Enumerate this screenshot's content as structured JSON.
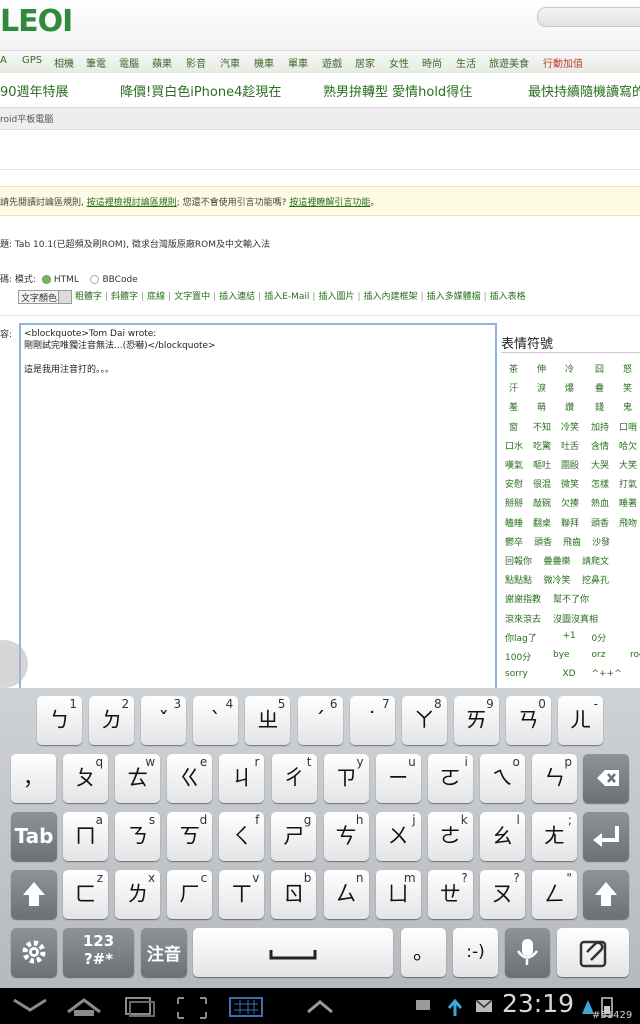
{
  "header": {
    "logo_text": "LEOI",
    "nav": [
      "A",
      "GPS",
      "相機",
      "筆電",
      "電腦",
      "蘋果",
      "影音",
      "汽車",
      "機車",
      "單車",
      "遊戲",
      "居家",
      "女性",
      "時尚",
      "生活",
      "旅遊美食",
      "行動加值"
    ],
    "marquee": [
      "90週年特展",
      "降價!買白色iPhone4趁現在",
      "熟男拚轉型 愛情hold得住",
      "最快持續隨機讀寫的"
    ],
    "breadcrumb": "roid平板電腦"
  },
  "notice": {
    "prefix": "請先閱讀討論區規則,",
    "link1": "按這裡檢視討論區規則",
    "middle": "; 您還不會使用引言功能嗎?",
    "link2": "按這裡瞭解引言功能",
    "suffix": "。"
  },
  "form": {
    "subject_label": "題:",
    "subject_value": "Tab 10.1(已超頻及刷ROM), 徵求台灣版原廠ROM及中文輸入法",
    "mode_label": "模式:",
    "mode_html": "HTML",
    "mode_bbcode": "BBCode",
    "mode_prefix": "碼:",
    "color_select": "文字顏色",
    "tools": [
      "粗體字",
      "斜體字",
      "底線",
      "文字置中",
      "插入連結",
      "插入E-Mail",
      "插入圖片",
      "插入內建框架",
      "插入多媒體檔",
      "插入表格"
    ],
    "content_label": "容:",
    "content_lines": [
      "<blockquote>Tom Dai wrote:",
      "剛剛試完唯獨注音無法...(恐嚇)</blockquote>",
      "",
      "這是我用注音打的。。。"
    ]
  },
  "emoticons": {
    "title": "表情符號",
    "rows": [
      [
        "茶",
        "伸",
        "冷",
        "囧",
        "怒"
      ],
      [
        "汗",
        "淚",
        "爆",
        "疊",
        "笑"
      ],
      [
        "羞",
        "萌",
        "讚",
        "錢",
        "鬼"
      ],
      [
        "窗",
        "不知",
        "冷笑",
        "加持",
        "口哨"
      ],
      [
        "口水",
        "吃驚",
        "吐舌",
        "含情",
        "哈欠"
      ],
      [
        "嘆氣",
        "嘔吐",
        "圍毆",
        "大哭",
        "大笑"
      ],
      [
        "安慰",
        "很混",
        "微笑",
        "怎樣",
        "打氣"
      ],
      [
        "掰掰",
        "敲碗",
        "欠揍",
        "熱血",
        "睡著"
      ],
      [
        "瞌睡",
        "翻桌",
        "聯拜",
        "頭香",
        "飛吻"
      ],
      [
        "鬱卒",
        "頭香",
        "飛齒",
        "沙發"
      ],
      [
        "回報你",
        "疊疊樂",
        "請爬文"
      ],
      [
        "點點點",
        "微冷笑",
        "挖鼻孔"
      ],
      [
        "謝謝指教",
        "幫不了你"
      ],
      [
        "滾來滾去",
        "沒圖沒真相"
      ],
      [
        "你lag了",
        "+1",
        "0分"
      ],
      [
        "100分",
        "bye",
        "orz",
        "rock"
      ],
      [
        "sorry",
        "XD",
        "^++^"
      ]
    ]
  },
  "keyboard": {
    "row1": [
      [
        "ㄅ",
        "1"
      ],
      [
        "ㄉ",
        "2"
      ],
      [
        "ˇ",
        "3"
      ],
      [
        "ˋ",
        "4"
      ],
      [
        "ㄓ",
        "5"
      ],
      [
        "ˊ",
        "6"
      ],
      [
        "˙",
        "7"
      ],
      [
        "ㄚ",
        "8"
      ],
      [
        "ㄞ",
        "9"
      ],
      [
        "ㄢ",
        "0"
      ],
      [
        "ㄦ",
        "-"
      ]
    ],
    "row2": [
      [
        "，",
        ""
      ],
      [
        "ㄆ",
        "q"
      ],
      [
        "ㄊ",
        "w"
      ],
      [
        "ㄍ",
        "e"
      ],
      [
        "ㄐ",
        "r"
      ],
      [
        "ㄔ",
        "t"
      ],
      [
        "ㄗ",
        "y"
      ],
      [
        "ㄧ",
        "u"
      ],
      [
        "ㄛ",
        "i"
      ],
      [
        "ㄟ",
        "o"
      ],
      [
        "ㄣ",
        "p"
      ]
    ],
    "row3": [
      [
        "ㄇ",
        "a"
      ],
      [
        "ㄋ",
        "s"
      ],
      [
        "ㄎ",
        "d"
      ],
      [
        "ㄑ",
        "f"
      ],
      [
        "ㄕ",
        "g"
      ],
      [
        "ㄘ",
        "h"
      ],
      [
        "ㄨ",
        "j"
      ],
      [
        "ㄜ",
        "k"
      ],
      [
        "ㄠ",
        "l"
      ],
      [
        "ㄤ",
        ";"
      ]
    ],
    "row4": [
      [
        "ㄈ",
        "z"
      ],
      [
        "ㄌ",
        "x"
      ],
      [
        "ㄏ",
        "c"
      ],
      [
        "ㄒ",
        "v"
      ],
      [
        "ㄖ",
        "b"
      ],
      [
        "ㄙ",
        "n"
      ],
      [
        "ㄩ",
        "m"
      ],
      [
        "ㄝ",
        "?"
      ],
      [
        "ㄡ",
        "?"
      ],
      [
        "ㄥ",
        "\""
      ]
    ],
    "tab_label": "Tab",
    "sym_label": "123\n?#*",
    "ime_label": "注音",
    "period": "。",
    "smiley": ":-)"
  },
  "system": {
    "clock": "23:19",
    "image_id": "#51429"
  }
}
